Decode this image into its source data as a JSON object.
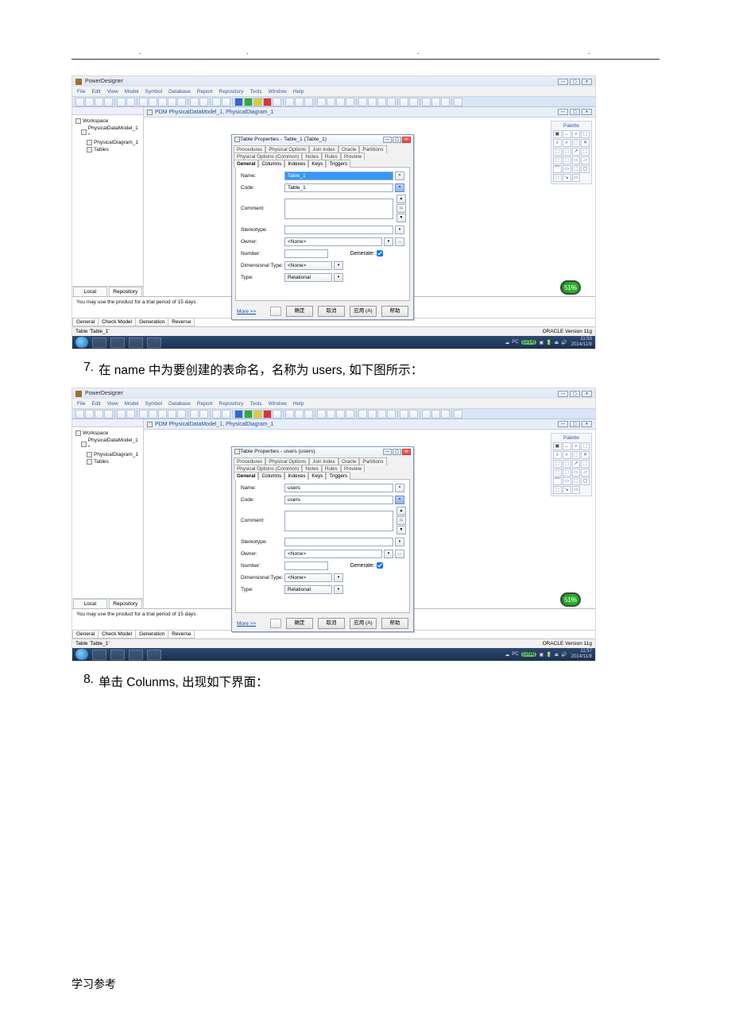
{
  "doc": {
    "step7": "在 name 中为要创建的表命名，名称为 users, 如下图所示：",
    "step7_num": "7.",
    "step8": "单击 Colunms, 出现如下界面：",
    "step8_num": "8.",
    "footer": "学习参考"
  },
  "app": {
    "title": "PowerDesigner",
    "menu": [
      "File",
      "Edit",
      "View",
      "Model",
      "Symbol",
      "Database",
      "Report",
      "Repository",
      "Tools",
      "Window",
      "Help"
    ],
    "diagram_tab": "PDM PhysicalDataModel_1, PhysicalDiagram_1",
    "palette_title": "Palette",
    "palette_icons": [
      "▣",
      "↔",
      "⌕",
      "⬚",
      "⌕",
      "⌕",
      "⬚",
      "✕",
      "⬚",
      "⬚",
      "↗",
      "⬚",
      "⬚",
      "⬚",
      "▭",
      "▱",
      "⌒",
      "▭",
      "⬚",
      "▢",
      "⬚",
      "↘",
      "▭"
    ],
    "tree": {
      "root": "Workspace",
      "model": "PhysicalDataModel_1 *",
      "diagram": "PhysicalDiagram_1",
      "tables": "Tables"
    },
    "side_tabs": {
      "local": "Local",
      "repo": "Repository"
    },
    "trial_msg": "You may use the product for a trial period of 15 days.",
    "msg_tabs": [
      "General",
      "Check Model",
      "Generation",
      "Reverse"
    ],
    "status_left": "Table 'Table_1'",
    "status_right": "ORACLE Version 11g",
    "tray_pc": "PC",
    "tray_net": "(2/14)",
    "clock": {
      "time": "11:53",
      "date": "2014/11/8"
    },
    "clock2": {
      "time": "11:57",
      "date": "2014/11/8"
    },
    "tray_net2": "(2/08)",
    "badge": "51%"
  },
  "dlg_common": {
    "back_tabs": [
      "Procedures",
      "Physical Options",
      "Join Index",
      "Oracle",
      "Partitions"
    ],
    "back_tabs2": [
      "Physical Options (Common)",
      "Notes",
      "Rules",
      "Preview"
    ],
    "front_tabs": [
      "General",
      "Columns",
      "Indexes",
      "Keys",
      "Triggers"
    ],
    "labels": {
      "name": "Name:",
      "code": "Code:",
      "comment": "Comment:",
      "stereotype": "Stereotype:",
      "owner": "Owner:",
      "number": "Number:",
      "generate": "Generate:",
      "dim": "Dimensional Type:",
      "type": "Type:"
    },
    "owner_value": "<None>",
    "dim_value": "<None>",
    "type_value": "Relational",
    "more": "More >>",
    "ok": "确定",
    "cancel": "取消",
    "apply": "应用 (A)",
    "help": "帮助"
  },
  "dlg1": {
    "title": "Table Properties - Table_1 (Table_1)",
    "name_value": "Table_1",
    "code_value": "Table_1"
  },
  "dlg2": {
    "title": "Table Properties - users (users)",
    "name_value": "users",
    "code_value": "users"
  }
}
